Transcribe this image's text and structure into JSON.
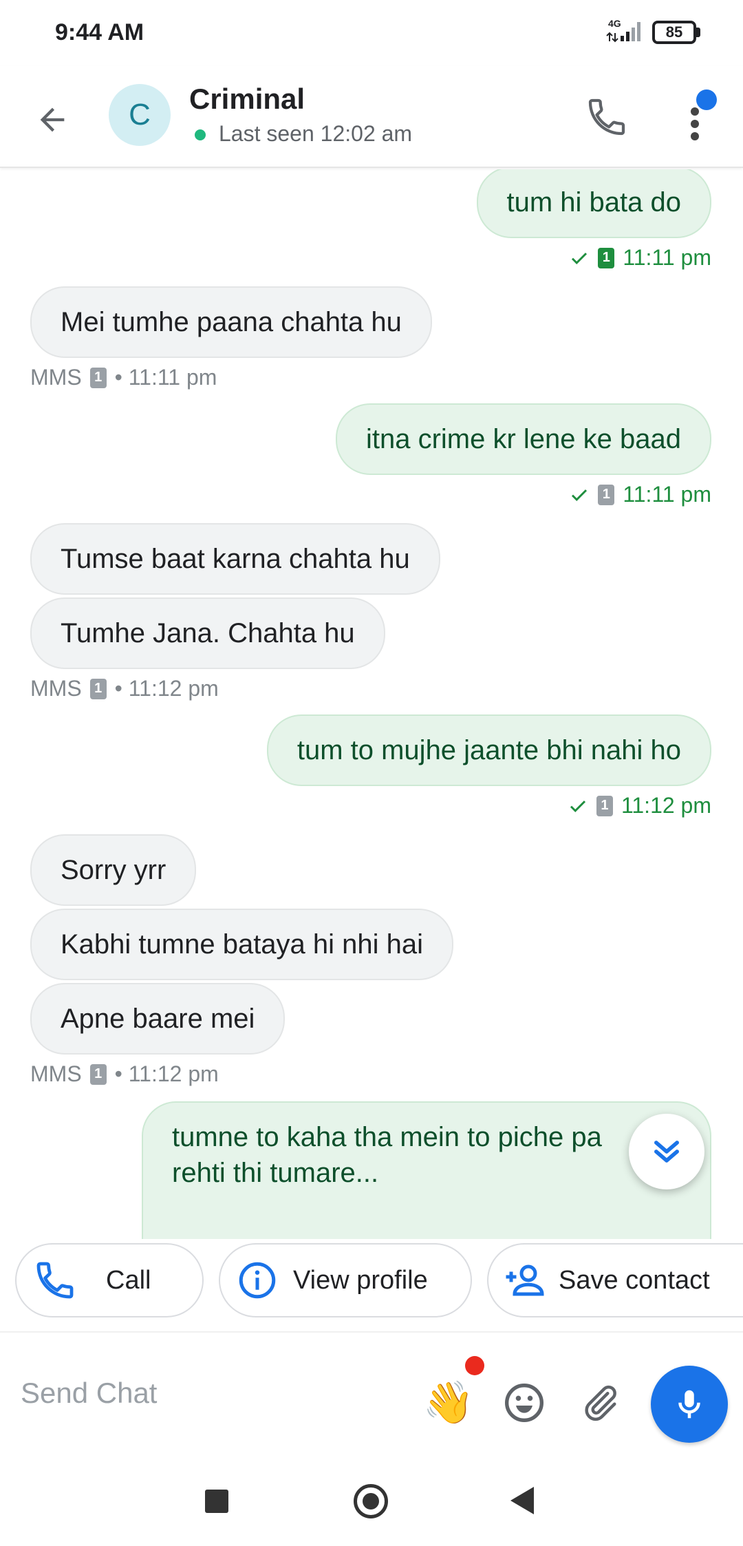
{
  "status_bar": {
    "time": "9:44 AM",
    "network": "4G",
    "battery": "85"
  },
  "header": {
    "avatar_letter": "C",
    "contact_name": "Criminal",
    "last_seen": "Last seen 12:02 am"
  },
  "messages": [
    {
      "direction": "out",
      "text": "tum hi bata do"
    },
    {
      "direction": "out_meta",
      "sim": "1",
      "time": "11:11 pm"
    },
    {
      "direction": "in",
      "text": "Mei tumhe paana chahta hu"
    },
    {
      "direction": "in_meta",
      "label": "MMS",
      "sim": "1",
      "time": "• 11:11 pm"
    },
    {
      "direction": "out",
      "text": "itna crime kr lene ke baad"
    },
    {
      "direction": "out_meta",
      "sim": "1",
      "time": "11:11 pm"
    },
    {
      "direction": "in",
      "text": "Tumse baat karna chahta hu"
    },
    {
      "direction": "in",
      "text": "Tumhe Jana. Chahta hu"
    },
    {
      "direction": "in_meta",
      "label": "MMS",
      "sim": "1",
      "time": "• 11:12 pm"
    },
    {
      "direction": "out",
      "text": "tum to mujhe jaante bhi nahi ho"
    },
    {
      "direction": "out_meta",
      "sim": "1",
      "time": "11:12 pm"
    },
    {
      "direction": "in",
      "text": "Sorry yrr"
    },
    {
      "direction": "in",
      "text": "Kabhi tumne bataya hi nhi hai"
    },
    {
      "direction": "in",
      "text": "Apne baare mei"
    },
    {
      "direction": "in_meta",
      "label": "MMS",
      "sim": "1",
      "time": "• 11:12 pm"
    },
    {
      "direction": "out",
      "text_line1": "tumne to kaha tha mein to piche pa",
      "text_line2": "rehti thi tumare..."
    }
  ],
  "chips": {
    "call": "Call",
    "view_profile": "View profile",
    "save_contact": "Save contact"
  },
  "composer": {
    "placeholder": "Send Chat"
  },
  "colors": {
    "accent": "#1a73e8",
    "outgoing_bubble": "#e6f4ea",
    "incoming_bubble": "#f1f3f4",
    "delivered_green": "#1e8e3e"
  }
}
